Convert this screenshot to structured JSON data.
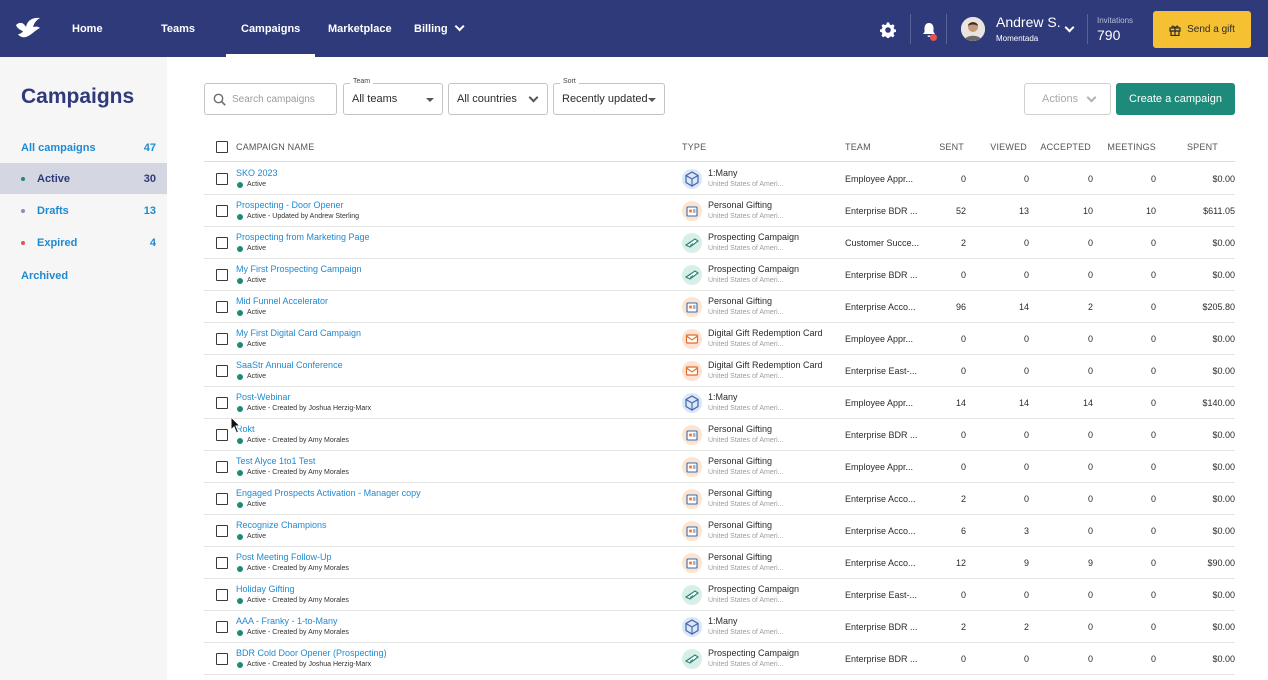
{
  "nav": {
    "items": [
      {
        "label": "Home"
      },
      {
        "label": "Teams"
      },
      {
        "label": "Campaigns"
      },
      {
        "label": "Marketplace"
      },
      {
        "label": "Billing"
      }
    ],
    "user": {
      "name": "Andrew S.",
      "org": "Momentada"
    },
    "invitations": {
      "label": "Invitations",
      "value": "790"
    },
    "send_gift": "Send a gift"
  },
  "sidebar": {
    "title": "Campaigns",
    "items": [
      {
        "label": "All campaigns",
        "count": "47"
      },
      {
        "label": "Active",
        "count": "30"
      },
      {
        "label": "Drafts",
        "count": "13"
      },
      {
        "label": "Expired",
        "count": "4"
      },
      {
        "label": "Archived",
        "count": ""
      }
    ]
  },
  "filters": {
    "search_placeholder": "Search campaigns",
    "team": {
      "label": "Team",
      "value": "All teams"
    },
    "country": {
      "value": "All countries"
    },
    "sort": {
      "label": "Sort",
      "value": "Recently updated"
    },
    "actions": "Actions",
    "create": "Create a campaign"
  },
  "table": {
    "headers": {
      "name": "CAMPAIGN NAME",
      "type": "TYPE",
      "team": "TEAM",
      "sent": "SENT",
      "viewed": "VIEWED",
      "accepted": "ACCEPTED",
      "meetings": "MEETINGS",
      "spent": "SPENT"
    },
    "rows": [
      {
        "name": "SKO 2023",
        "status": "Active",
        "type": "1:Many",
        "icon": "one-to-many",
        "country": "United States of Ameri...",
        "team": "Employee Appr...",
        "sent": "0",
        "viewed": "0",
        "accepted": "0",
        "meetings": "0",
        "spent": "$0.00"
      },
      {
        "name": "Prospecting - Door Opener",
        "status": "Active - Updated by Andrew Sterling",
        "type": "Personal Gifting",
        "icon": "personal",
        "country": "United States of Ameri...",
        "team": "Enterprise BDR ...",
        "sent": "52",
        "viewed": "13",
        "accepted": "10",
        "meetings": "10",
        "spent": "$611.05"
      },
      {
        "name": "Prospecting from Marketing Page",
        "status": "Active",
        "type": "Prospecting Campaign",
        "icon": "prospecting",
        "country": "United States of Ameri...",
        "team": "Customer Succe...",
        "sent": "2",
        "viewed": "0",
        "accepted": "0",
        "meetings": "0",
        "spent": "$0.00"
      },
      {
        "name": "My First Prospecting Campaign",
        "status": "Active",
        "type": "Prospecting Campaign",
        "icon": "prospecting",
        "country": "United States of Ameri...",
        "team": "Enterprise BDR ...",
        "sent": "0",
        "viewed": "0",
        "accepted": "0",
        "meetings": "0",
        "spent": "$0.00"
      },
      {
        "name": "Mid Funnel Accelerator",
        "status": "Active",
        "type": "Personal Gifting",
        "icon": "personal",
        "country": "United States of Ameri...",
        "team": "Enterprise Acco...",
        "sent": "96",
        "viewed": "14",
        "accepted": "2",
        "meetings": "0",
        "spent": "$205.80"
      },
      {
        "name": "My First Digital Card Campaign",
        "status": "Active",
        "type": "Digital Gift Redemption Card",
        "icon": "digital",
        "country": "United States of Ameri...",
        "team": "Employee Appr...",
        "sent": "0",
        "viewed": "0",
        "accepted": "0",
        "meetings": "0",
        "spent": "$0.00"
      },
      {
        "name": "SaaStr Annual Conference",
        "status": "Active",
        "type": "Digital Gift Redemption Card",
        "icon": "digital",
        "country": "United States of Ameri...",
        "team": "Enterprise East-...",
        "sent": "0",
        "viewed": "0",
        "accepted": "0",
        "meetings": "0",
        "spent": "$0.00"
      },
      {
        "name": "Post-Webinar",
        "status": "Active - Created by Joshua Herzig-Marx",
        "type": "1:Many",
        "icon": "one-to-many",
        "country": "United States of Ameri...",
        "team": "Employee Appr...",
        "sent": "14",
        "viewed": "14",
        "accepted": "14",
        "meetings": "0",
        "spent": "$140.00"
      },
      {
        "name": "Rokt",
        "status": "Active - Created by Amy Morales",
        "type": "Personal Gifting",
        "icon": "personal",
        "country": "United States of Ameri...",
        "team": "Enterprise BDR ...",
        "sent": "0",
        "viewed": "0",
        "accepted": "0",
        "meetings": "0",
        "spent": "$0.00"
      },
      {
        "name": "Test Alyce 1to1 Test",
        "status": "Active - Created by Amy Morales",
        "type": "Personal Gifting",
        "icon": "personal",
        "country": "United States of Ameri...",
        "team": "Employee Appr...",
        "sent": "0",
        "viewed": "0",
        "accepted": "0",
        "meetings": "0",
        "spent": "$0.00"
      },
      {
        "name": "Engaged Prospects Activation - Manager copy",
        "status": "Active",
        "type": "Personal Gifting",
        "icon": "personal",
        "country": "United States of Ameri...",
        "team": "Enterprise Acco...",
        "sent": "2",
        "viewed": "0",
        "accepted": "0",
        "meetings": "0",
        "spent": "$0.00"
      },
      {
        "name": "Recognize Champions",
        "status": "Active",
        "type": "Personal Gifting",
        "icon": "personal",
        "country": "United States of Ameri...",
        "team": "Enterprise Acco...",
        "sent": "6",
        "viewed": "3",
        "accepted": "0",
        "meetings": "0",
        "spent": "$0.00"
      },
      {
        "name": "Post Meeting Follow-Up",
        "status": "Active - Created by Amy Morales",
        "type": "Personal Gifting",
        "icon": "personal",
        "country": "United States of Ameri...",
        "team": "Enterprise Acco...",
        "sent": "12",
        "viewed": "9",
        "accepted": "9",
        "meetings": "0",
        "spent": "$90.00"
      },
      {
        "name": "Holiday Gifting",
        "status": "Active - Created by Amy Morales",
        "type": "Prospecting Campaign",
        "icon": "prospecting",
        "country": "United States of Ameri...",
        "team": "Enterprise East-...",
        "sent": "0",
        "viewed": "0",
        "accepted": "0",
        "meetings": "0",
        "spent": "$0.00"
      },
      {
        "name": "AAA - Franky - 1-to-Many",
        "status": "Active - Created by Amy Morales",
        "type": "1:Many",
        "icon": "one-to-many",
        "country": "United States of Ameri...",
        "team": "Enterprise BDR ...",
        "sent": "2",
        "viewed": "2",
        "accepted": "0",
        "meetings": "0",
        "spent": "$0.00"
      },
      {
        "name": "BDR Cold Door Opener (Prospecting)",
        "status": "Active - Created by Joshua Herzig-Marx",
        "type": "Prospecting Campaign",
        "icon": "prospecting",
        "country": "United States of Ameri...",
        "team": "Enterprise BDR ...",
        "sent": "0",
        "viewed": "0",
        "accepted": "0",
        "meetings": "0",
        "spent": "$0.00"
      }
    ]
  },
  "colors": {
    "nav_bg": "#2f3a7b",
    "accent": "#1e8a7a",
    "link": "#1f8ad1",
    "gift_button": "#f5c132"
  }
}
